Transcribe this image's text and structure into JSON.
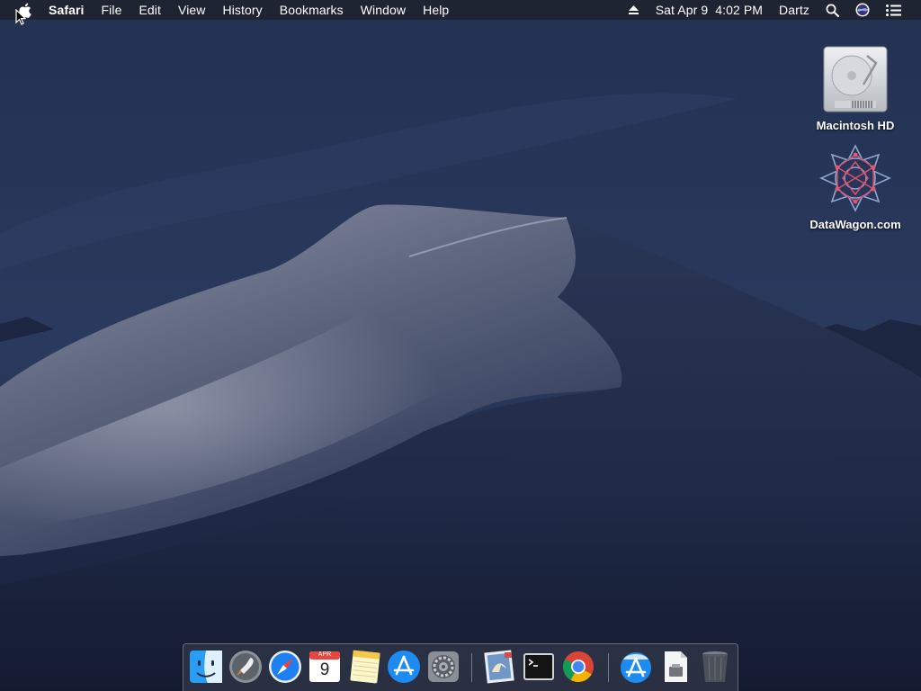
{
  "menubar": {
    "app_name": "Safari",
    "menus": [
      "File",
      "Edit",
      "View",
      "History",
      "Bookmarks",
      "Window",
      "Help"
    ],
    "datetime": "Sat Apr 9  4:02 PM",
    "user": "Dartz",
    "icons": [
      "apple-icon",
      "eject-icon",
      "spotlight-search-icon",
      "siri-icon",
      "notification-center-icon"
    ]
  },
  "desktop": {
    "icons": [
      {
        "label": "Macintosh HD",
        "icon": "hard-drive-icon"
      },
      {
        "label": "DataWagon.com",
        "icon": "datawagon-logo-icon"
      }
    ]
  },
  "dock": {
    "apps": [
      {
        "name": "Finder",
        "icon": "finder-icon",
        "running": true
      },
      {
        "name": "Launchpad",
        "icon": "launchpad-icon",
        "running": false
      },
      {
        "name": "Safari",
        "icon": "safari-icon",
        "running": true
      },
      {
        "name": "Calendar",
        "icon": "calendar-icon",
        "running": false,
        "month": "APR",
        "day": "9"
      },
      {
        "name": "Notes",
        "icon": "notes-icon",
        "running": false
      },
      {
        "name": "App Store",
        "icon": "app-store-icon",
        "running": false
      },
      {
        "name": "System Preferences",
        "icon": "system-preferences-icon",
        "running": false
      },
      {
        "name": "Mail",
        "icon": "mail-icon",
        "running": false
      },
      {
        "name": "Terminal",
        "icon": "terminal-icon",
        "running": true
      },
      {
        "name": "Chrome",
        "icon": "chrome-icon",
        "running": true
      },
      {
        "name": "Applications",
        "icon": "applications-folder-icon",
        "running": false
      },
      {
        "name": "Downloads",
        "icon": "downloads-file-icon",
        "running": false
      },
      {
        "name": "Trash",
        "icon": "trash-icon",
        "running": false
      }
    ]
  },
  "colors": {
    "sky": "#1d2948",
    "dune_light": "#9aa0b4",
    "dune_shadow": "#1c2746",
    "safari_blue": "#1e7ff0"
  }
}
